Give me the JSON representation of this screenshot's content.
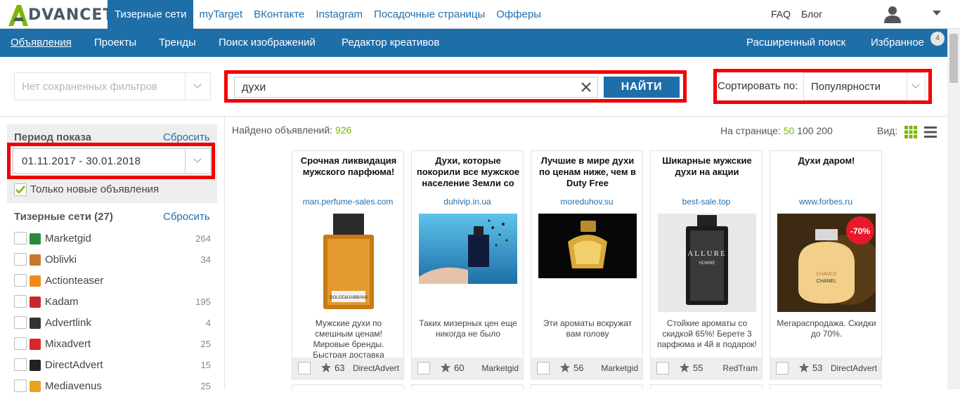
{
  "app": {
    "logo_text": "DVANCETS"
  },
  "top_tabs": [
    "Тизерные сети",
    "myTarget",
    "ВКонтакте",
    "Instagram",
    "Посадочные страницы",
    "Офферы"
  ],
  "top_right": {
    "faq": "FAQ",
    "blog": "Блог"
  },
  "nav": {
    "items": [
      "Объявления",
      "Проекты",
      "Тренды",
      "Поиск изображений",
      "Редактор креативов"
    ],
    "advanced": "Расширенный поиск",
    "favorites": "Избранное",
    "favorites_count": "4"
  },
  "filters": {
    "saved_placeholder": "Нет сохраненных фильтров",
    "search_value": "духи",
    "find_button": "НАЙТИ",
    "sort_label": "Сортировать по:",
    "sort_value": "Популярности"
  },
  "sidebar": {
    "period_title": "Период показа",
    "reset": "Сбросить",
    "date_range": "01.11.2017 - 30.01.2018",
    "new_only": "Только новые объявления",
    "networks_title": "Тизерные сети (27)",
    "networks": [
      {
        "name": "Marketgid",
        "count": "264",
        "color": "#2a8a3a"
      },
      {
        "name": "Oblivki",
        "count": "34",
        "color": "#c8782a"
      },
      {
        "name": "Actionteaser",
        "count": "",
        "color": "#f08a1c"
      },
      {
        "name": "Kadam",
        "count": "195",
        "color": "#c8262c"
      },
      {
        "name": "Advertlink",
        "count": "4",
        "color": "#333333"
      },
      {
        "name": "Mixadvert",
        "count": "25",
        "color": "#d9262c"
      },
      {
        "name": "DirectAdvert",
        "count": "15",
        "color": "#222222"
      },
      {
        "name": "Mediavenus",
        "count": "25",
        "color": "#e8a21c"
      }
    ]
  },
  "results": {
    "found_label": "Найдено объявлений:",
    "found_count": "926",
    "per_page_label": "На странице:",
    "per_page": [
      "50",
      "100",
      "200"
    ],
    "view_label": "Вид:"
  },
  "cards": [
    {
      "title": "Срочная ликвидация мужского парфюма!",
      "domain": "man.perfume-sales.com",
      "desc": "Мужские духи по смешным ценам! Мировые бренды. Быстрая доставка",
      "rating": "63",
      "network": "DirectAdvert"
    },
    {
      "title": "Духи, которые покорили все мужское население Земли со",
      "domain": "duhivip.in.ua",
      "desc": "Таких мизерных цен еще никогда не было",
      "rating": "60",
      "network": "Marketgid"
    },
    {
      "title": "Лучшие в мире духи по ценам ниже, чем в Duty Free",
      "domain": "moreduhov.su",
      "desc": "Эти ароматы вскружат вам голову",
      "rating": "56",
      "network": "Marketgid"
    },
    {
      "title": "Шикарные мужские духи на акции",
      "domain": "best-sale.top",
      "desc": "Стойкие ароматы со скидкой 65%! Берете 3 парфюма и 4й в подарок!",
      "rating": "55",
      "network": "RedTram"
    },
    {
      "title": "Духи даром!",
      "domain": "www.forbes.ru",
      "desc": "Мегараспродажа. Скидки до 70%.",
      "rating": "53",
      "network": "DirectAdvert"
    }
  ],
  "img_text": {
    "dg": "DOLCE&GABBANA",
    "allure": "ALLURE",
    "homme": "HOMME",
    "chance": "CHANCE",
    "chanel": "CHANEL",
    "discount": "-70%"
  }
}
